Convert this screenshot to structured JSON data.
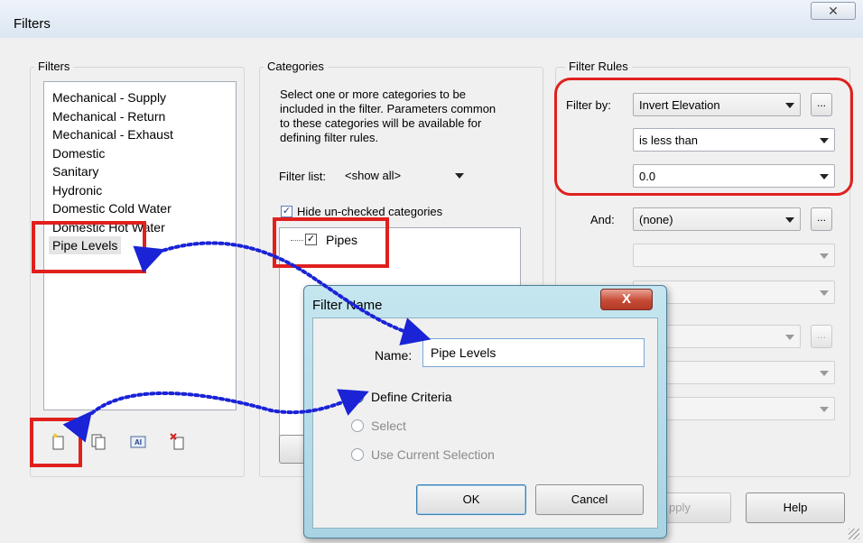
{
  "window": {
    "title": "Filters",
    "close_symbol": "✕"
  },
  "filters_panel": {
    "label": "Filters",
    "items": [
      "Mechanical - Supply",
      "Mechanical - Return",
      "Mechanical - Exhaust",
      "Domestic",
      "Sanitary",
      "Hydronic",
      "Domestic Cold Water",
      "Domestic Hot Water",
      "Pipe Levels"
    ],
    "selected": "Pipe Levels",
    "toolbar_icons": [
      "new-filter-icon",
      "duplicate-filter-icon",
      "rename-filter-icon",
      "delete-filter-icon"
    ],
    "rename_icon_text": "AI"
  },
  "categories_panel": {
    "label": "Categories",
    "description": "Select one or more categories to be included in the filter.  Parameters common to these categories will be available for defining filter rules.",
    "filter_list_label": "Filter list:",
    "filter_list_value": "<show all>",
    "hide_unchecked_label": "Hide un-checked categories",
    "hide_unchecked_checked": true,
    "tree_items": [
      {
        "label": "Pipes",
        "checked": true
      }
    ]
  },
  "filter_rules_panel": {
    "label": "Filter Rules",
    "filter_by_label": "Filter by:",
    "filter_by_value": "Invert Elevation",
    "operator_value": "is less than",
    "value_value": "0.0",
    "and_label": "And:",
    "and_value": "(none)",
    "partial_and_value": "e)",
    "ellipsis": "..."
  },
  "buttons": {
    "apply": "Apply",
    "apply_visible": "pply",
    "help": "Help"
  },
  "filter_name_dialog": {
    "title": "Filter Name",
    "close_symbol": "X",
    "name_label": "Name:",
    "name_value": "Pipe Levels",
    "options": [
      {
        "label": "Define Criteria",
        "selected": true,
        "enabled": true
      },
      {
        "label": "Select",
        "selected": false,
        "enabled": false
      },
      {
        "label": "Use Current Selection",
        "selected": false,
        "enabled": false
      }
    ],
    "ok": "OK",
    "cancel": "Cancel"
  },
  "colors": {
    "highlight_red": "#e0201d",
    "arrow_blue": "#1a23d6",
    "dialog_frame": "#a9d3e2"
  }
}
